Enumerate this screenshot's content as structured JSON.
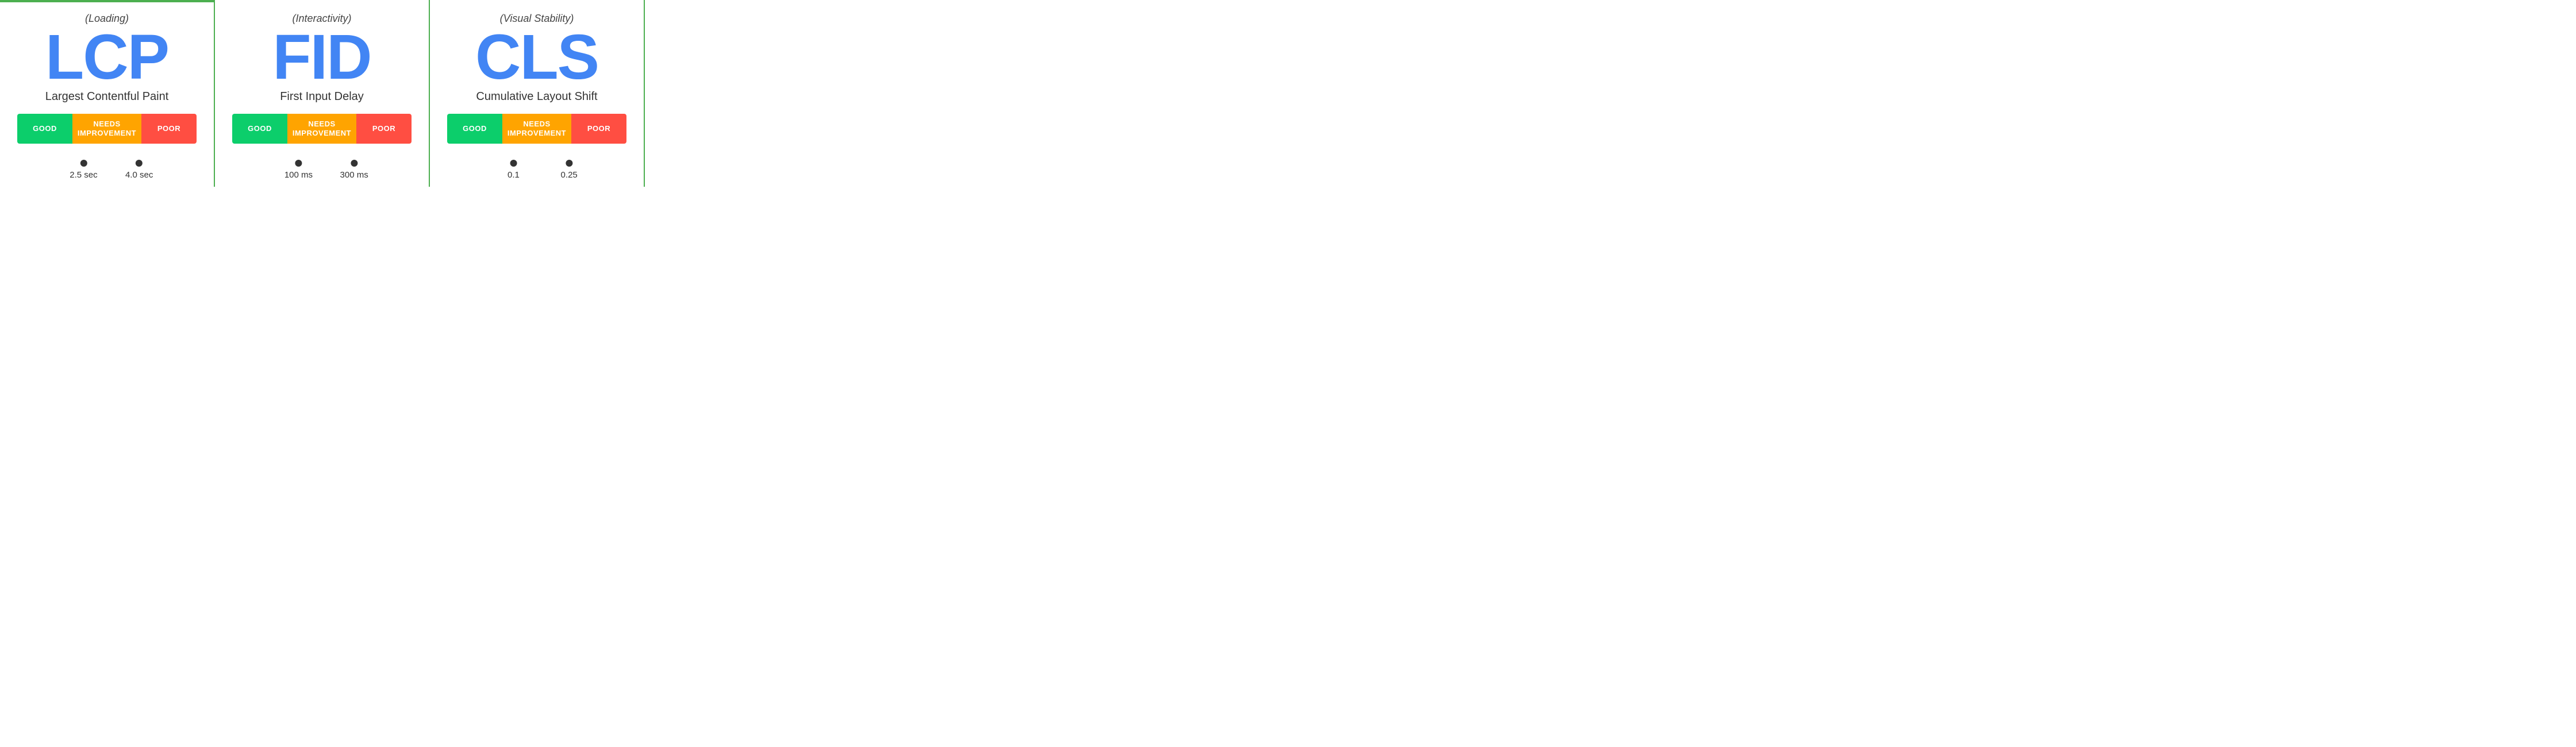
{
  "panels": [
    {
      "id": "lcp",
      "subtitle": "(Loading)",
      "acronym": "LCP",
      "name": "Largest Contentful Paint",
      "bar": {
        "good": "GOOD",
        "needs": "NEEDS\nIMPROVEMENT",
        "poor": "POOR"
      },
      "marker1": "2.5 sec",
      "marker2": "4.0 sec"
    },
    {
      "id": "fid",
      "subtitle": "(Interactivity)",
      "acronym": "FID",
      "name": "First Input Delay",
      "bar": {
        "good": "GOOD",
        "needs": "NEEDS\nIMPROVEMENT",
        "poor": "POOR"
      },
      "marker1": "100 ms",
      "marker2": "300 ms"
    },
    {
      "id": "cls",
      "subtitle": "(Visual Stability)",
      "acronym": "CLS",
      "name": "Cumulative Layout Shift",
      "bar": {
        "good": "GOOD",
        "needs": "NEEDS\nIMPROVEMENT",
        "poor": "POOR"
      },
      "marker1": "0.1",
      "marker2": "0.25"
    }
  ],
  "colors": {
    "good": "#0cce6b",
    "needs": "#ffa400",
    "poor": "#ff4e42",
    "accent": "#4285f4",
    "border": "#4caf50"
  }
}
